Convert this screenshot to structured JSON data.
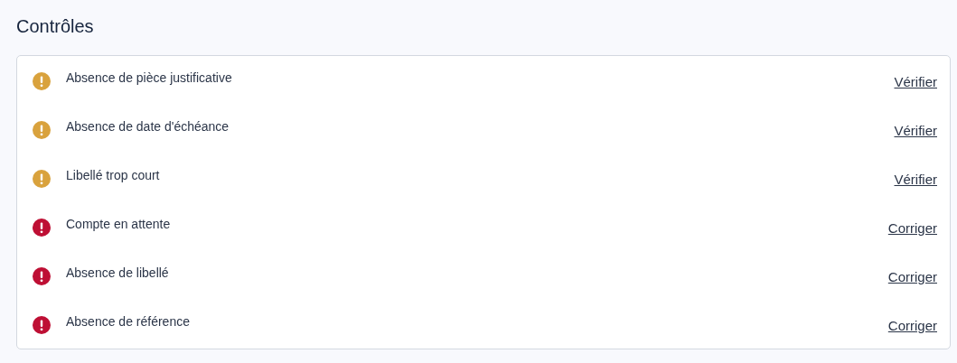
{
  "title": "Contrôles",
  "checks": [
    {
      "kind": "warning",
      "label": "Absence de pièce justificative",
      "action": "Vérifier"
    },
    {
      "kind": "warning",
      "label": "Absence de date d'échéance",
      "action": "Vérifier"
    },
    {
      "kind": "warning",
      "label": "Libellé trop court",
      "action": "Vérifier"
    },
    {
      "kind": "error",
      "label": "Compte en attente",
      "action": "Corriger"
    },
    {
      "kind": "error",
      "label": "Absence de libellé",
      "action": "Corriger"
    },
    {
      "kind": "error",
      "label": "Absence de référence",
      "action": "Corriger"
    }
  ]
}
